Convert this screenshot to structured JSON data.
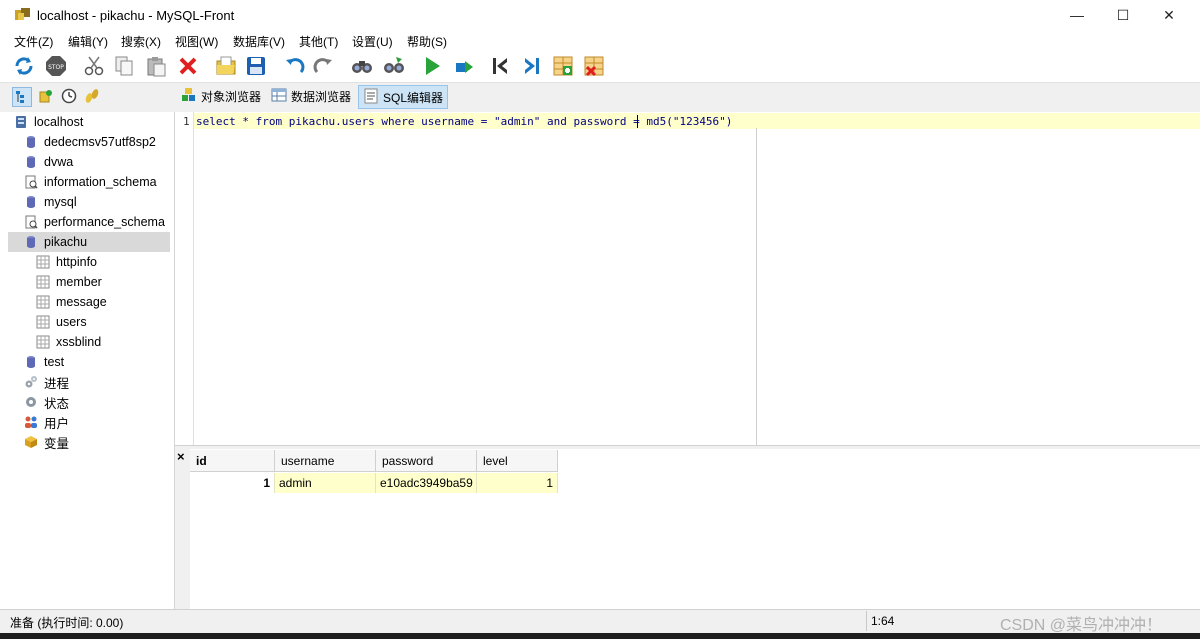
{
  "window": {
    "title": "localhost - pikachu - MySQL-Front",
    "minimize": "—",
    "maximize": "☐",
    "close": "✕"
  },
  "menu": [
    "文件(Z)",
    "编辑(Y)",
    "搜索(X)",
    "视图(W)",
    "数据库(V)",
    "其他(T)",
    "设置(U)",
    "帮助(S)"
  ],
  "toolbar_icons": [
    "refresh-icon",
    "stop-icon",
    "cut-icon",
    "copy-icon",
    "paste-icon",
    "delete-icon",
    "open-folder-icon",
    "save-icon",
    "undo-icon",
    "redo-icon",
    "find-icon",
    "replace-icon",
    "run-icon",
    "run-selection-icon",
    "first-icon",
    "last-icon",
    "insert-row-icon",
    "delete-row-icon"
  ],
  "view_tabs": {
    "object_browser": "对象浏览器",
    "data_browser": "数据浏览器",
    "sql_editor": "SQL编辑器"
  },
  "tree": {
    "root": "localhost",
    "databases": [
      "dedecmsv57utf8sp2",
      "dvwa",
      "information_schema",
      "mysql",
      "performance_schema",
      "pikachu"
    ],
    "tables": [
      "httpinfo",
      "member",
      "message",
      "users",
      "xssblind"
    ],
    "after": [
      "test"
    ],
    "extras": [
      "进程",
      "状态",
      "用户",
      "变量"
    ]
  },
  "editor": {
    "line_number": "1",
    "sql": "select * from pikachu.users where username = \"admin\" and password = md5(\"123456\")"
  },
  "grid": {
    "close": "×",
    "columns": [
      "id",
      "username",
      "password",
      "level"
    ],
    "rows": [
      [
        "1",
        "admin",
        "e10adc3949ba59",
        "1"
      ]
    ]
  },
  "status": {
    "message": "准备  (执行时间: 0.00)",
    "position": "1:64",
    "watermark": "CSDN @菜鸟冲冲冲！"
  }
}
